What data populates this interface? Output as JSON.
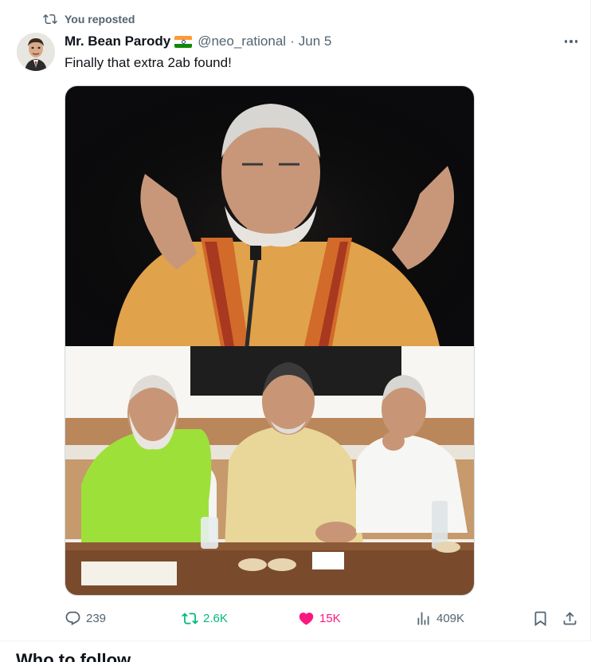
{
  "repost_banner": {
    "label": "You reposted",
    "icon": "repost-icon"
  },
  "author": {
    "display_name": "Mr. Bean Parody",
    "flag_icon": "india-flag-icon",
    "handle": "@neo_rational",
    "separator": "·",
    "date": "Jun 5"
  },
  "tweet": {
    "text": "Finally that extra 2ab found!"
  },
  "media": {
    "type": "two-panel photo collage"
  },
  "actions": {
    "replies": "239",
    "reposts": "2.6K",
    "likes": "15K",
    "views": "409K"
  },
  "colors": {
    "text_primary": "#0f1419",
    "text_secondary": "#536471",
    "repost_active": "#00ba7c",
    "like_active": "#f91880",
    "border": "#cfd9de"
  },
  "sidebar_section": {
    "title": "Who to follow"
  }
}
